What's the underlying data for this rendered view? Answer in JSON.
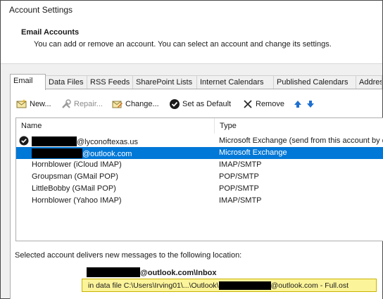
{
  "window": {
    "title": "Account Settings"
  },
  "header": {
    "title": "Email Accounts",
    "description": "You can add or remove an account. You can select an account and change its settings."
  },
  "tabs": [
    {
      "label": "Email",
      "active": true
    },
    {
      "label": "Data Files"
    },
    {
      "label": "RSS Feeds"
    },
    {
      "label": "SharePoint Lists"
    },
    {
      "label": "Internet Calendars"
    },
    {
      "label": "Published Calendars"
    },
    {
      "label": "Address Books"
    }
  ],
  "toolbar": {
    "new_label": "New...",
    "repair_label": "Repair...",
    "change_label": "Change...",
    "default_label": "Set as Default",
    "remove_label": "Remove"
  },
  "list": {
    "columns": {
      "name": "Name",
      "type": "Type"
    },
    "rows": [
      {
        "name": "@lyconoftexas.us",
        "type": "Microsoft Exchange (send from this account by default)",
        "default": true
      },
      {
        "name": "@outlook.com",
        "type": "Microsoft Exchange",
        "selected": true
      },
      {
        "name": "Hornblower (iCloud IMAP)",
        "type": "IMAP/SMTP"
      },
      {
        "name": "Groupsman (GMail POP)",
        "type": "POP/SMTP"
      },
      {
        "name": "LittleBobby (GMail POP)",
        "type": "POP/SMTP"
      },
      {
        "name": "Hornblower (Yahoo IMAP)",
        "type": "IMAP/SMTP"
      }
    ]
  },
  "delivery": {
    "label": "Selected account delivers new messages to the following location:",
    "folder": "@outlook.com\\Inbox",
    "datafile_prefix": "in data file C:\\Users\\Irving01\\...\\Outlook\\",
    "datafile_suffix": "@outlook.com - Full.ost"
  },
  "colors": {
    "selection": "#0078d7",
    "highlight": "#fcf49a",
    "arrow": "#1e6fd0"
  },
  "icons": [
    "new-email-icon",
    "repair-icon",
    "change-icon",
    "checkmark-icon",
    "remove-x-icon",
    "move-up-arrow-icon",
    "move-down-arrow-icon",
    "default-check-icon"
  ]
}
